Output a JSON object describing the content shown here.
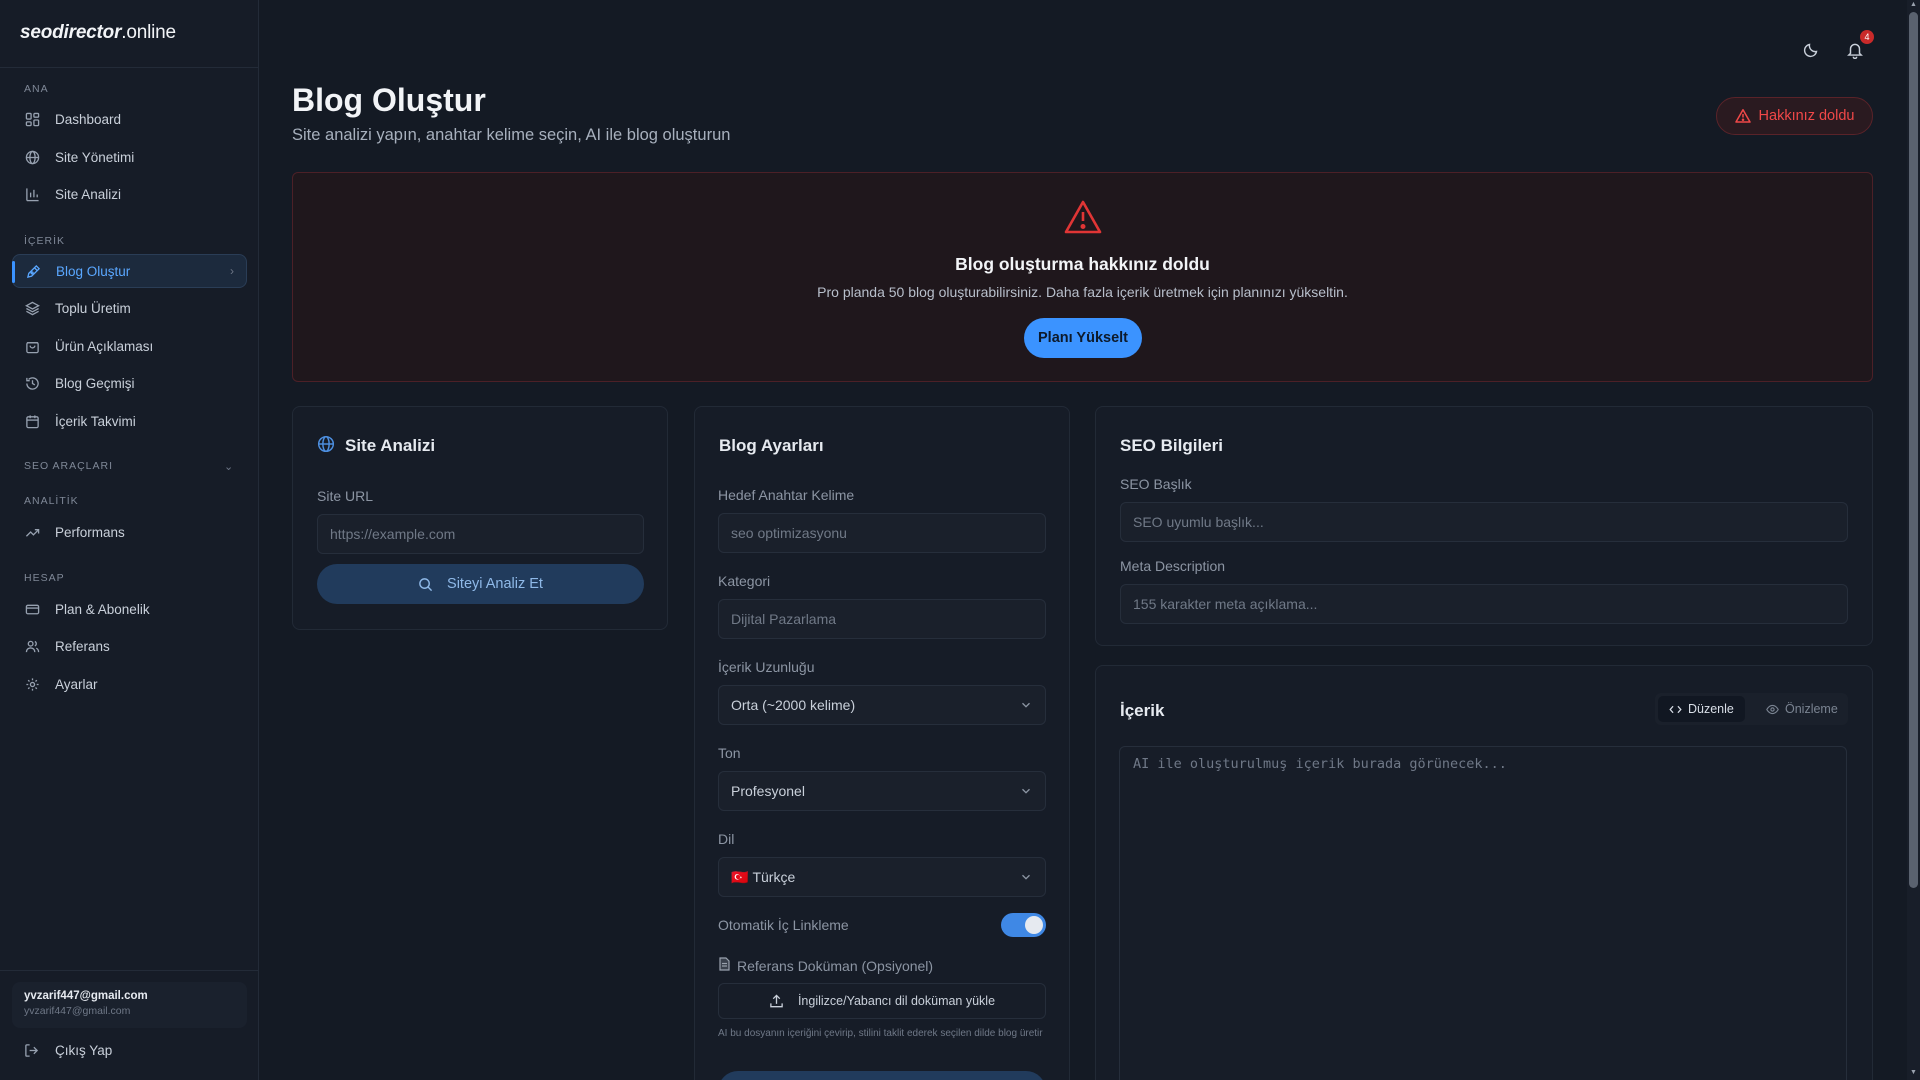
{
  "brand": {
    "prefix": "seodirector",
    "suffix": ".online"
  },
  "sidebar": {
    "sections": [
      {
        "label": "ANA"
      },
      {
        "label": "İÇERİK"
      },
      {
        "label": "SEO ARAÇLARI"
      },
      {
        "label": "ANALİTİK"
      },
      {
        "label": "HESAP"
      }
    ],
    "items": [
      {
        "label": "Dashboard",
        "icon": "dashboard-icon"
      },
      {
        "label": "Site Yönetimi",
        "icon": "globe-icon"
      },
      {
        "label": "Site Analizi",
        "icon": "bar-chart-icon"
      },
      {
        "label": "Blog Oluştur",
        "icon": "pen-icon",
        "active": true
      },
      {
        "label": "Toplu Üretim",
        "icon": "layers-icon"
      },
      {
        "label": "Ürün Açıklaması",
        "icon": "bag-icon"
      },
      {
        "label": "Blog Geçmişi",
        "icon": "history-icon"
      },
      {
        "label": "İçerik Takvimi",
        "icon": "calendar-icon"
      },
      {
        "label": "Performans",
        "icon": "trending-up-icon"
      },
      {
        "label": "Plan & Abonelik",
        "icon": "credit-card-icon"
      },
      {
        "label": "Referans",
        "icon": "users-icon"
      },
      {
        "label": "Ayarlar",
        "icon": "gear-icon"
      }
    ],
    "user": {
      "name": "yvzarif447@gmail.com",
      "email": "yvzarif447@gmail.com"
    },
    "logout_label": "Çıkış Yap"
  },
  "topbar": {
    "notification_count": "4"
  },
  "header": {
    "title": "Blog Oluştur",
    "subtitle": "Site analizi yapın, anahtar kelime seçin, AI ile blog oluşturun",
    "quota_label": "Hakkınız doldu"
  },
  "alert": {
    "title": "Blog oluşturma hakkınız doldu",
    "description": "Pro planda 50 blog oluşturabilirsiniz. Daha fazla içerik üretmek için planınızı yükseltin.",
    "button_label": "Planı Yükselt"
  },
  "site_analysis": {
    "title": "Site Analizi",
    "url_label": "Site URL",
    "url_placeholder": "https://example.com",
    "button_label": "Siteyi Analiz Et"
  },
  "blog_settings": {
    "title": "Blog Ayarları",
    "keyword_label": "Hedef Anahtar Kelime",
    "keyword_placeholder": "seo optimizasyonu",
    "category_label": "Kategori",
    "category_placeholder": "Dijital Pazarlama",
    "length_label": "İçerik Uzunluğu",
    "length_value": "Orta (~2000 kelime)",
    "tone_label": "Ton",
    "tone_value": "Profesyonel",
    "language_label": "Dil",
    "language_flag": "🇹🇷",
    "language_value": "Türkçe",
    "auto_link_label": "Otomatik İç Linkleme",
    "auto_link_enabled": true,
    "reference_label": "Referans Doküman (Opsiyonel)",
    "upload_label": "İngilizce/Yabancı dil doküman yükle",
    "upload_note": "AI bu dosyanın içeriğini çevirip, stilini taklit ederek seçilen dilde blog üretir"
  },
  "seo_info": {
    "title": "SEO Bilgileri",
    "seo_title_label": "SEO Başlık",
    "seo_title_placeholder": "SEO uyumlu başlık...",
    "meta_label": "Meta Description",
    "meta_placeholder": "155 karakter meta açıklama..."
  },
  "content": {
    "title": "İçerik",
    "tab_edit": "Düzenle",
    "tab_preview": "Önizleme",
    "placeholder": "AI ile oluşturulmuş içerik burada görünecek..."
  },
  "colors": {
    "accent": "#3b93ff",
    "danger": "#e03535",
    "background": "#141a24"
  }
}
